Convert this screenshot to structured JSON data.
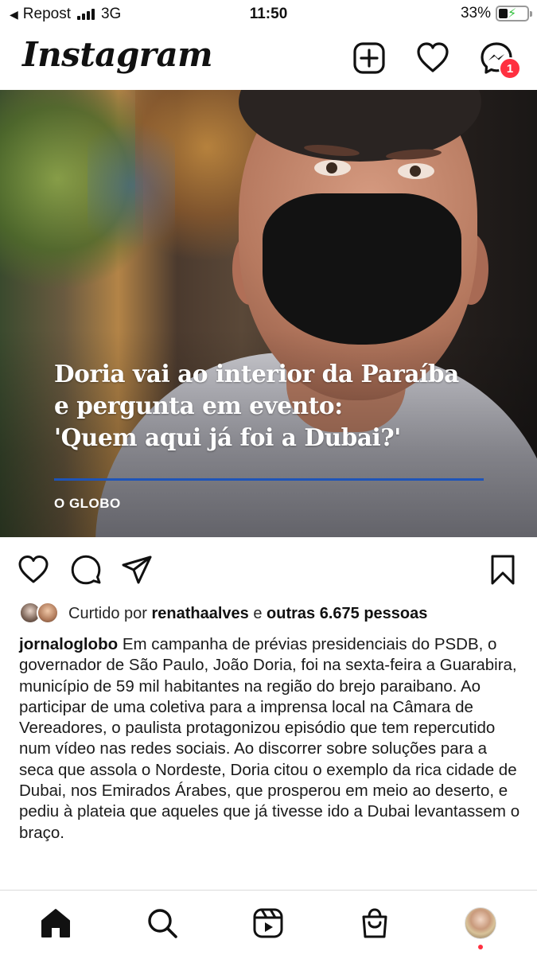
{
  "status_bar": {
    "back_label": "Repost",
    "network": "3G",
    "time": "11:50",
    "battery": "33%"
  },
  "header": {
    "logo": "Instagram",
    "messages_badge": "1",
    "icons": [
      "new-post-icon",
      "heart-icon",
      "messenger-icon"
    ]
  },
  "post": {
    "headline_lines": [
      "Doria vai ao interior da Paraíba",
      "e pergunta em evento:",
      "'Quem aqui já foi a Dubai?'"
    ],
    "image_brand": "O GLOBO",
    "action_icons": [
      "like-icon",
      "comment-icon",
      "share-icon",
      "save-icon"
    ],
    "likes": {
      "prefix": "Curtido por",
      "user": "renathaalves",
      "connector": "e",
      "others": "outras 6.675 pessoas"
    },
    "caption": {
      "username": "jornaloglobo",
      "text": "Em campanha de prévias presidenciais do PSDB, o governador de São Paulo, João Doria, foi na sexta-feira a Guarabira, município de 59 mil habitantes na região do brejo paraibano. Ao participar de uma coletiva para a imprensa local na Câmara de Vereadores, o paulista protagonizou episódio que tem repercutido num vídeo nas redes sociais. Ao discorrer sobre soluções para a seca que assola o Nordeste, Doria citou o exemplo da rica cidade de Dubai, nos Emirados Árabes, que prosperou em meio ao deserto, e pediu à plateia que aqueles que já tivesse ido a Dubai levantassem o braço."
    }
  },
  "bottom_nav": {
    "items": [
      "home-icon",
      "search-icon",
      "reels-icon",
      "shop-icon",
      "profile-avatar"
    ]
  },
  "colors": {
    "badge": "#ff3040",
    "headline_rule": "#1e54b8",
    "battery_charge": "#2fbf3a"
  }
}
